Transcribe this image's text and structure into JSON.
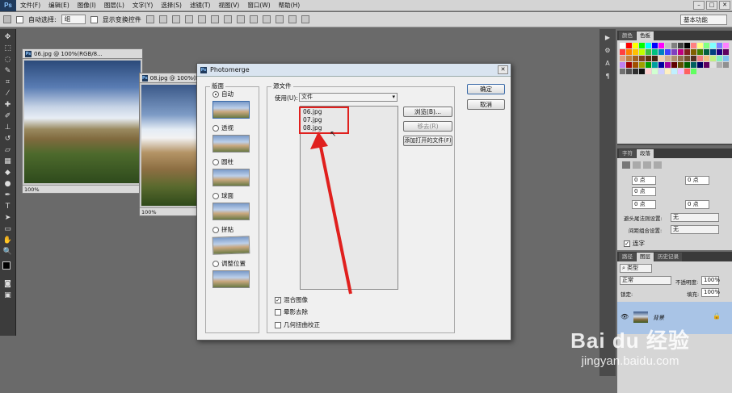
{
  "app": {
    "logo": "Ps"
  },
  "menubar": {
    "items": [
      "文件(F)",
      "编辑(E)",
      "图像(I)",
      "图层(L)",
      "文字(Y)",
      "选择(S)",
      "滤镜(T)",
      "视图(V)",
      "窗口(W)",
      "帮助(H)"
    ]
  },
  "options": {
    "auto_select_label": "自动选择:",
    "auto_select_value": "组",
    "show_transform_label": "显示变换控件",
    "workspace": "基本功能"
  },
  "documents": [
    {
      "title": "06.jpg @ 100%(RGB/8...",
      "zoom": "100%"
    },
    {
      "title": "08.jpg @ 100%(RGB/8...",
      "zoom": "100%"
    }
  ],
  "dialog": {
    "title": "Photomerge",
    "layout_group": "版面",
    "layouts": [
      {
        "label": "自动",
        "selected": true
      },
      {
        "label": "透视",
        "selected": false
      },
      {
        "label": "圆柱",
        "selected": false
      },
      {
        "label": "球面",
        "selected": false
      },
      {
        "label": "拼贴",
        "selected": false
      },
      {
        "label": "调整位置",
        "selected": false
      }
    ],
    "source_group": "源文件",
    "use_label": "使用(U):",
    "use_value": "文件",
    "files": [
      "06.jpg",
      "07.jpg",
      "08.jpg"
    ],
    "buttons": {
      "browse": "浏览(B)...",
      "remove": "移去(R)",
      "add_open": "添加打开的文件(F)",
      "ok": "确定",
      "cancel": "取消"
    },
    "options": [
      {
        "label": "混合图像",
        "checked": true
      },
      {
        "label": "晕影去除",
        "checked": false
      },
      {
        "label": "几何扭曲校正",
        "checked": false
      }
    ],
    "annotation_color": "#e0201e"
  },
  "right_panels": {
    "color_tabs": [
      "颜色",
      "色板"
    ],
    "para_tabs": [
      "字符",
      "段落"
    ],
    "para_fields": [
      "0 点",
      "0 点",
      "0 点",
      "0 点",
      "0 点"
    ],
    "avoid_label": "避头尾法则设置:",
    "avoid_value": "无",
    "spacing_label": "间距组合设置:",
    "spacing_value": "无",
    "hyphenate_label": "连字",
    "layers_tabs": [
      "路径",
      "图层",
      "历史记录"
    ],
    "layers_filter": "类型",
    "blend_mode": "正常",
    "opacity_label": "不透明度:",
    "opacity_value": "100%",
    "lock_label": "锁定:",
    "fill_label": "填充:",
    "fill_value": "100%",
    "layer_name": "背景"
  },
  "watermark": {
    "brand": "Bai du 经验",
    "url": "jingyan.baidu.com"
  },
  "swatch_colors": [
    "#ffffff",
    "#ff0000",
    "#ffff00",
    "#00ff00",
    "#00ffff",
    "#0000ff",
    "#ff00ff",
    "#c0c0c0",
    "#808080",
    "#404040",
    "#000000",
    "#ff8080",
    "#ffff80",
    "#80ff80",
    "#80ffff",
    "#8080ff",
    "#ff80ff",
    "#ff4040",
    "#ff8000",
    "#ffc000",
    "#c0ff00",
    "#40c040",
    "#00c080",
    "#0080c0",
    "#4040ff",
    "#8040c0",
    "#c00080",
    "#802020",
    "#806000",
    "#408000",
    "#006040",
    "#004080",
    "#200080",
    "#600060",
    "#e0a080",
    "#c08040",
    "#a06020",
    "#804020",
    "#603010",
    "#402010",
    "#f0d0b0",
    "#d0b090",
    "#b09070",
    "#907050",
    "#705030",
    "#503020",
    "#f08080",
    "#f0c080",
    "#c0f080",
    "#80f0c0",
    "#80c0f0",
    "#c080f0",
    "#a00000",
    "#a05000",
    "#a0a000",
    "#00a000",
    "#00a0a0",
    "#0000a0",
    "#a000a0",
    "#600000",
    "#605000",
    "#006000",
    "#006060",
    "#000060",
    "#600060",
    "#e0e0e0",
    "#b0b0b0",
    "#909090",
    "#707070",
    "#505050",
    "#303030",
    "#101010",
    "#ffd0d0",
    "#d0ffd0",
    "#d0d0ff",
    "#fff0c0",
    "#c0f0ff",
    "#f0c0ff",
    "#ff6060",
    "#60ff60"
  ]
}
